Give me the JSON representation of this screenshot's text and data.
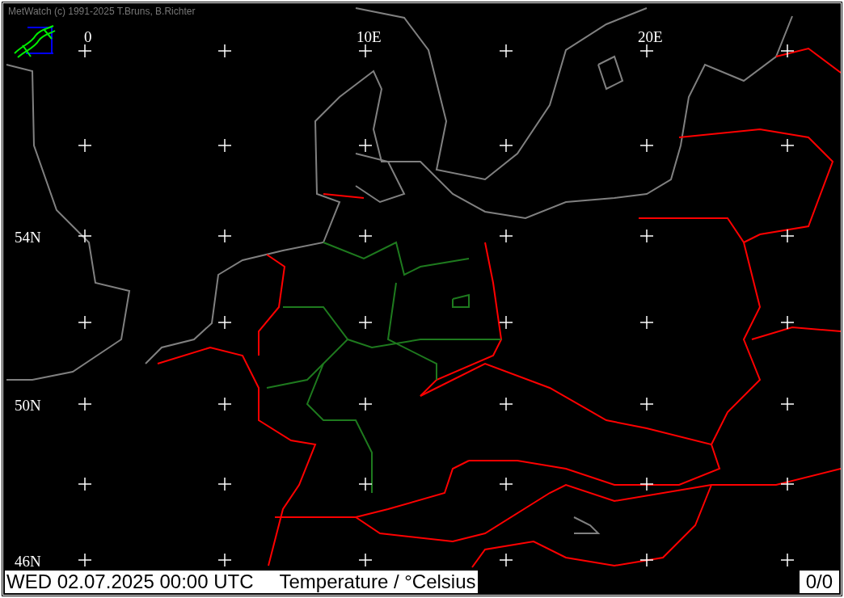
{
  "credit": "MetWatch  (c) 1991-2025 T.Bruns, B.Richter",
  "longitude_labels": [
    "0",
    "10E",
    "20E"
  ],
  "latitude_labels": [
    "54N",
    "50N",
    "46N"
  ],
  "status_bar": {
    "valid_time": "WED 02.07.2025 00:00 UTC",
    "parameter": "Temperature / °Celsius",
    "frame_counter": "0/0"
  }
}
